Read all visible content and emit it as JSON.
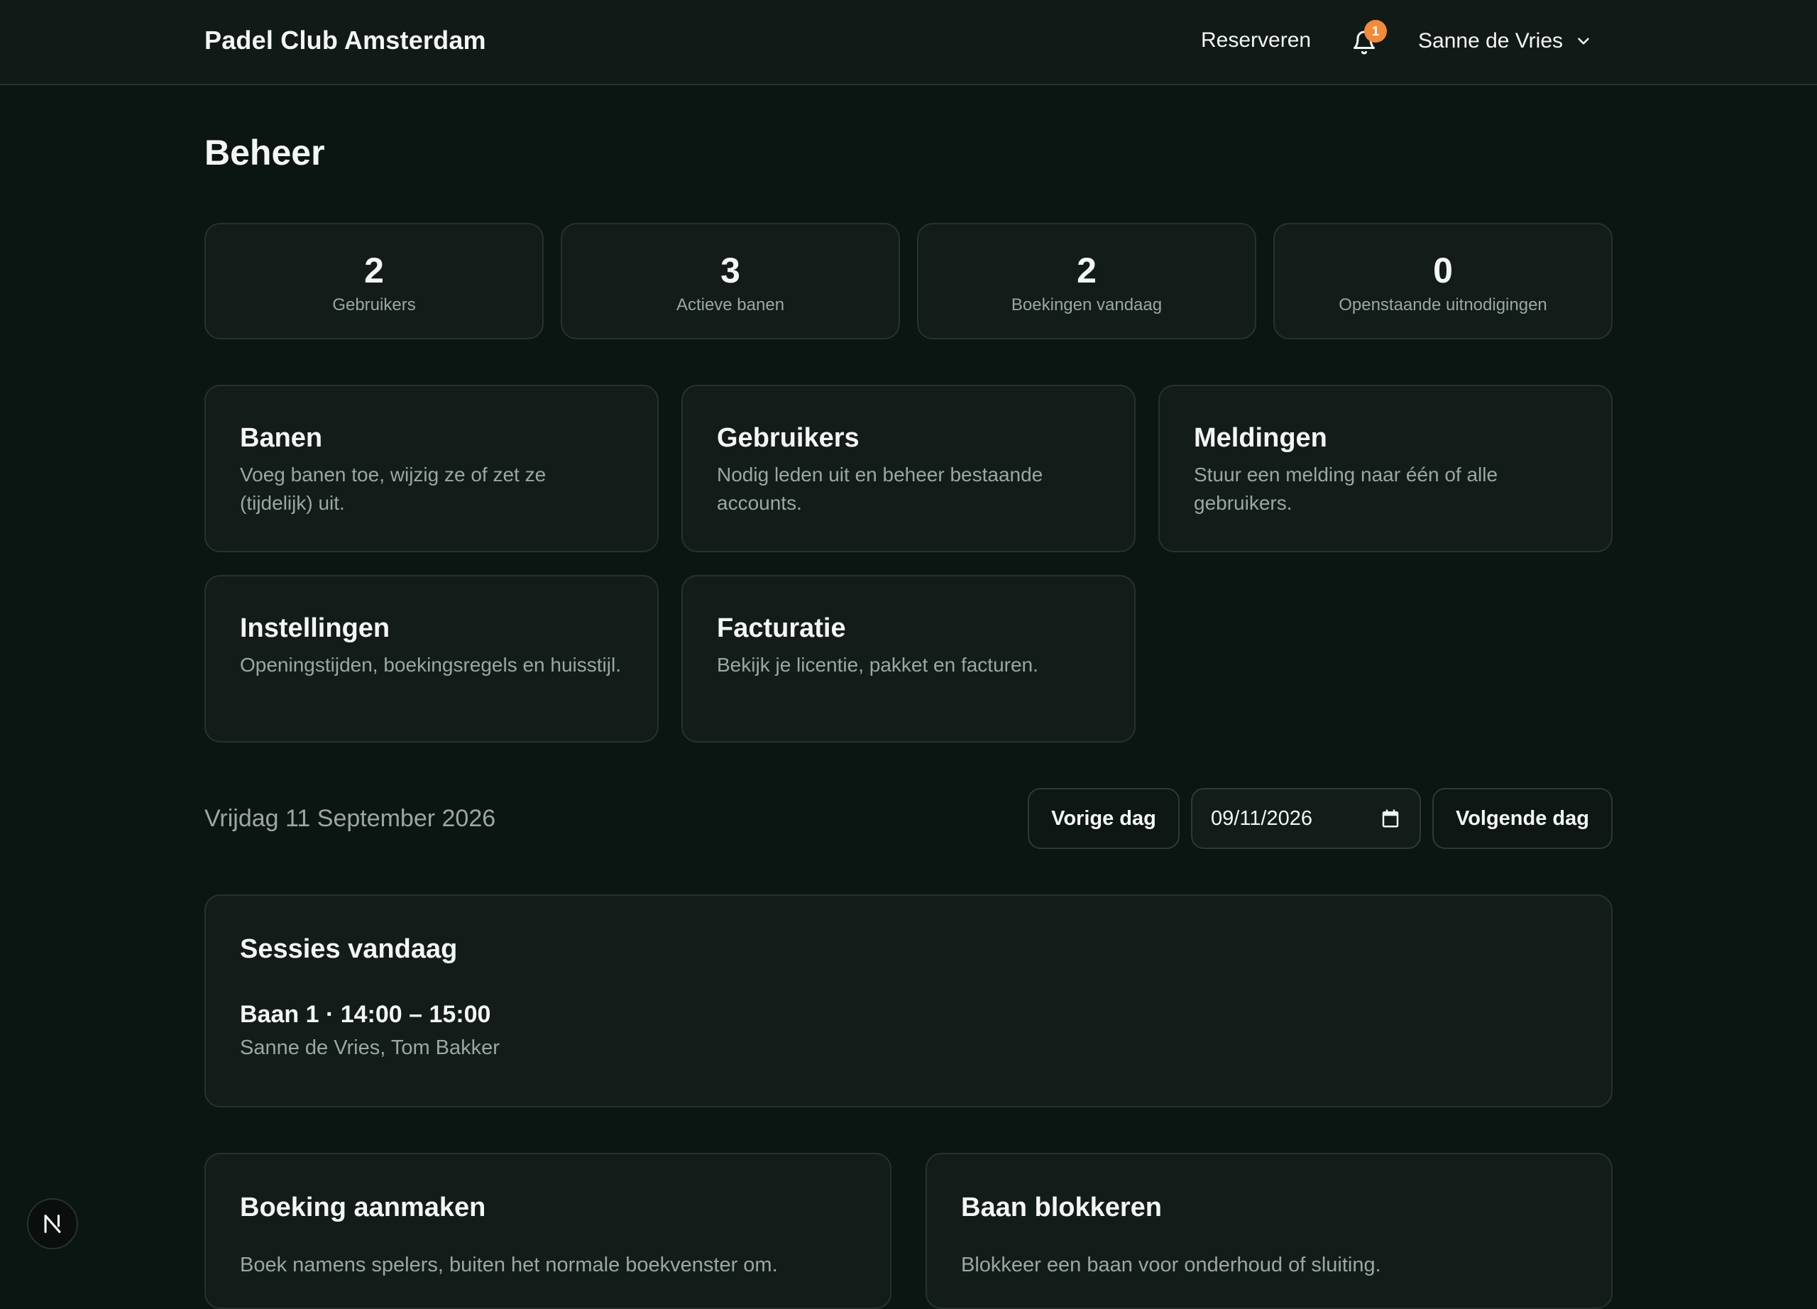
{
  "header": {
    "brand": "Padel Club Amsterdam",
    "reserve_label": "Reserveren",
    "notifications_count": "1",
    "user_name": "Sanne de Vries",
    "icons": {
      "notifications": "bell-icon",
      "user_menu": "chevron-down-icon"
    }
  },
  "page": {
    "title": "Beheer"
  },
  "stats": [
    {
      "value": "2",
      "label": "Gebruikers"
    },
    {
      "value": "3",
      "label": "Actieve banen"
    },
    {
      "value": "2",
      "label": "Boekingen vandaag"
    },
    {
      "value": "0",
      "label": "Openstaande uitnodigingen"
    }
  ],
  "cards": [
    {
      "title": "Banen",
      "desc": "Voeg banen toe, wijzig ze of zet ze (tijdelijk) uit."
    },
    {
      "title": "Gebruikers",
      "desc": "Nodig leden uit en beheer bestaande accounts."
    },
    {
      "title": "Meldingen",
      "desc": "Stuur een melding naar één of alle gebruikers."
    },
    {
      "title": "Instellingen",
      "desc": "Openingstijden, boekingsregels en huisstijl."
    },
    {
      "title": "Facturatie",
      "desc": "Bekijk je licentie, pakket en facturen."
    }
  ],
  "day_nav": {
    "date_label": "Vrijdag 11 September 2026",
    "prev_label": "Vorige dag",
    "date_value": "09/11/2026",
    "next_label": "Volgende dag",
    "calendar_icon": "calendar-icon"
  },
  "sessions": {
    "title": "Sessies vandaag",
    "items": [
      {
        "heading": "Baan 1 · 14:00 – 15:00",
        "players": "Sanne de Vries, Tom Bakker"
      }
    ]
  },
  "create_booking": {
    "title": "Boeking aanmaken",
    "desc": "Boek namens spelers, buiten het normale boekvenster om."
  },
  "block_court": {
    "title": "Baan blokkeren",
    "desc": "Blokkeer een baan voor onderhoud of sluiting."
  },
  "dev_badge": {
    "letter": "N"
  },
  "colors": {
    "background": "#0b1512",
    "card": "#131c19",
    "badge": "#f08a3c",
    "muted_text": "#9aa7a2"
  }
}
